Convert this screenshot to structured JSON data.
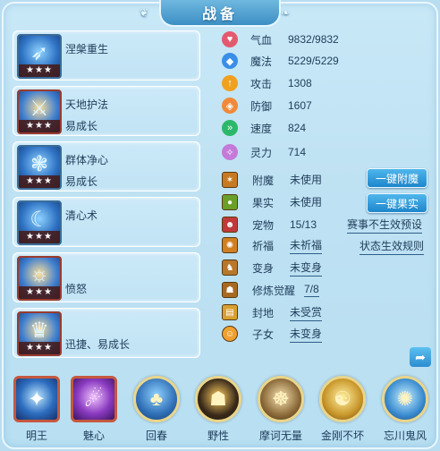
{
  "title": "战备",
  "skills": [
    {
      "name": "涅槃重生",
      "sub": "",
      "stars": "★★★",
      "icon": "bow-icon"
    },
    {
      "name": "天地护法",
      "sub": "易成长",
      "stars": "★★★",
      "icon": "guardian-icon"
    },
    {
      "name": "群体净心",
      "sub": "易成长",
      "stars": "★★★",
      "icon": "spirit-icon"
    },
    {
      "name": "清心术",
      "sub": "",
      "stars": "★★★",
      "icon": "dragon-icon"
    },
    {
      "name": "愤怒",
      "sub": "",
      "stars": "★★★",
      "icon": "fury-icon"
    },
    {
      "name": "迅捷、易成长",
      "sub": "",
      "stars": "★★★",
      "icon": "mask-icon"
    }
  ],
  "attributes": [
    {
      "name": "气血",
      "value": "9832/9832",
      "icon": "heart-icon",
      "color": "#e35a6e"
    },
    {
      "name": "魔法",
      "value": "5229/5229",
      "icon": "mana-icon",
      "color": "#3a8ee8"
    },
    {
      "name": "攻击",
      "value": "1308",
      "icon": "attack-icon",
      "color": "#f0a020"
    },
    {
      "name": "防御",
      "value": "1607",
      "icon": "defense-icon",
      "color": "#f08a3a"
    },
    {
      "name": "速度",
      "value": "824",
      "icon": "speed-icon",
      "color": "#2cb86a"
    },
    {
      "name": "灵力",
      "value": "714",
      "icon": "spirit-power-icon",
      "color": "#c47ad8"
    }
  ],
  "equip": [
    {
      "name": "附魔",
      "value": "未使用",
      "underline": false,
      "icon": "enchant-icon",
      "color": "#c77a22"
    },
    {
      "name": "果实",
      "value": "未使用",
      "underline": false,
      "icon": "fruit-icon",
      "color": "#6aa02a"
    },
    {
      "name": "宠物",
      "value": "15/13",
      "underline": false,
      "icon": "pet-icon",
      "color": "#c03a3a"
    },
    {
      "name": "祈福",
      "value": "未祈福",
      "underline": true,
      "icon": "bless-icon",
      "color": "#d08020"
    },
    {
      "name": "变身",
      "value": "未变身",
      "underline": true,
      "icon": "transform-icon",
      "color": "#b8782a"
    },
    {
      "name": "修炼觉醒",
      "value": "7/8",
      "underline": true,
      "icon": "awaken-icon",
      "color": "#a86a22"
    },
    {
      "name": "封地",
      "value": "未受赏",
      "underline": true,
      "icon": "fief-icon",
      "color": "#d8a030"
    },
    {
      "name": "子女",
      "value": "未变身",
      "underline": true,
      "icon": "child-icon",
      "color": "#f0a030"
    }
  ],
  "buttons": {
    "enchant": "一键附魔",
    "fruit": "一键果实"
  },
  "links": {
    "preset": "赛事不生效预设",
    "rule": "状态生效规则"
  },
  "bottom": [
    {
      "label": "明王",
      "shape": "square",
      "icon": "ming-wang-icon",
      "glyph": "✦"
    },
    {
      "label": "魅心",
      "shape": "square",
      "icon": "charm-icon",
      "glyph": "☄"
    },
    {
      "label": "回春",
      "shape": "circle",
      "icon": "rejuvenate-icon",
      "glyph": "♣"
    },
    {
      "label": "野性",
      "shape": "circle",
      "icon": "wild-icon",
      "glyph": "☗"
    },
    {
      "label": "摩诃无量",
      "shape": "circle",
      "icon": "mahe-icon",
      "glyph": "☸"
    },
    {
      "label": "金刚不坏",
      "shape": "circle",
      "icon": "vajra-icon",
      "glyph": "☯"
    },
    {
      "label": "忘川鬼风",
      "shape": "circle",
      "icon": "ghost-wind-icon",
      "glyph": "✺"
    }
  ]
}
